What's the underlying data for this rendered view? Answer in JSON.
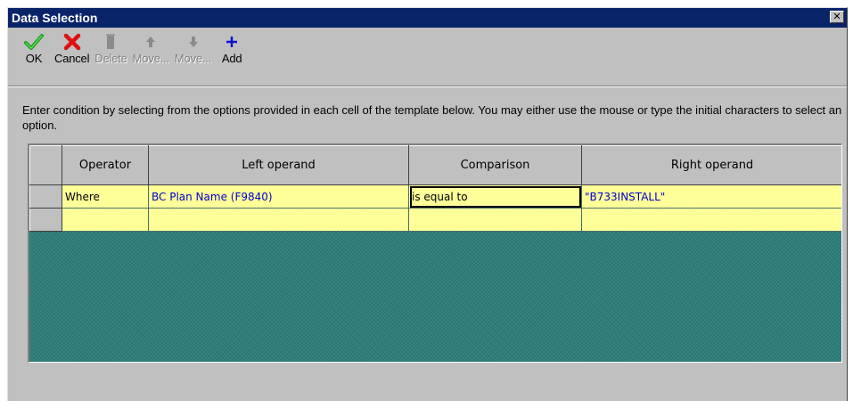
{
  "window": {
    "title": "Data Selection",
    "close_glyph": "✕"
  },
  "toolbar": {
    "buttons": [
      {
        "label": "OK",
        "icon": "check-icon",
        "enabled": true
      },
      {
        "label": "Cancel",
        "icon": "x-icon",
        "enabled": true
      },
      {
        "label": "Delete",
        "icon": "trash-icon",
        "enabled": false
      },
      {
        "label": "Move...",
        "icon": "move-up-icon",
        "enabled": false
      },
      {
        "label": "Move...",
        "icon": "move-down-icon",
        "enabled": false
      },
      {
        "label": "Add",
        "icon": "plus-icon",
        "enabled": true
      }
    ]
  },
  "instructions": "Enter condition by selecting from the options provided in each cell of the template below. You may either use the mouse or type the initial characters to select an option.",
  "grid": {
    "columns": [
      "Operator",
      "Left operand",
      "Comparison",
      "Right operand"
    ],
    "rows": [
      {
        "operator": "Where",
        "left": "BC Plan Name (F9840)",
        "comparison": "is equal to",
        "right": "\"B733INSTALL\""
      },
      {
        "operator": "",
        "left": "",
        "comparison": "",
        "right": ""
      }
    ]
  },
  "colors": {
    "titlebar": "#0a246a",
    "row_fill": "#ffff99",
    "grid_background": "#2e7f7b",
    "operand_text": "#0000cc",
    "ok_green": "#1a9e1a",
    "cancel_red": "#e01010",
    "add_blue": "#1010d0"
  }
}
